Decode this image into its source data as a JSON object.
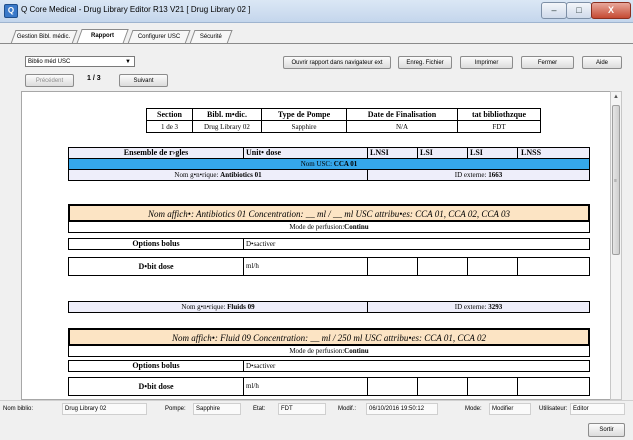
{
  "window": {
    "title": "Q Core Medical - Drug Library Editor R13 V21 [ Drug Library 02 ]",
    "app_icon": "Q",
    "minimize_glyph": "–",
    "maximize_glyph": "□",
    "close_glyph": "X"
  },
  "tabs": [
    {
      "label": "Gestion Bibl. médic."
    },
    {
      "label": "Rapport"
    },
    {
      "label": "Configurer USC"
    },
    {
      "label": "Sécurité"
    }
  ],
  "toolbar": {
    "biblio_select": "Biblio méd USC",
    "open_report": "Ouvrir rapport dans navigateur ext",
    "save_file": "Enreg. Fichier",
    "print": "Imprimer",
    "close": "Fermer",
    "help": "Aide",
    "previous": "Précédent",
    "page": "1 / 3",
    "next": "Suivant"
  },
  "summary": {
    "headers": [
      "Section",
      "Bibl. m•dic.",
      "Type de Pompe",
      "Date de Finalisation",
      "tat bibliothzque"
    ],
    "values": [
      "1 de 3",
      "Drug Library 02",
      "Sapphire",
      "N/A",
      "FDT"
    ]
  },
  "rules_header": {
    "ensemble": "Ensemble de r›gles",
    "unit": "Unit• dose",
    "lnsi": "LNSI",
    "lsi1": "LSI",
    "lsi2": "LSI",
    "lnss": "LNSS",
    "usc_prefix": "Nom USC: ",
    "usc_name": "CCA 01"
  },
  "drugs": [
    {
      "generic_prefix": "Nom g•n•rique: ",
      "generic_name": "Antibiotics 01",
      "ext_prefix": "ID externe: ",
      "ext_id": "1663",
      "display": "Nom affich•: Antibiotics 01 Concentration: __ ml / __ ml USC attribu•es: CCA 01, CCA 02, CCA 03",
      "mode_prefix": "Mode de perfusion:",
      "mode": "Continu",
      "bolus_label": "Options bolus",
      "bolus_value": "D•sactiver",
      "rate_label": "D•bit dose",
      "rate_unit": "ml/h"
    },
    {
      "generic_prefix": "Nom g•n•rique: ",
      "generic_name": "Fluids 09",
      "ext_prefix": "ID externe: ",
      "ext_id": "3293",
      "display": "Nom affich•: Fluid 09 Concentration: __ ml / 250 ml USC attribu•es: CCA 01, CCA 02",
      "mode_prefix": "Mode de perfusion:",
      "mode": "Continu",
      "bolus_label": "Options bolus",
      "bolus_value": "D•sactiver",
      "rate_label": "D•bit dose",
      "rate_unit": "ml/h"
    }
  ],
  "status": {
    "biblio_label": "Nom biblio:",
    "biblio_value": "Drug Library 02",
    "pump_label": "Pompe:",
    "pump_value": "Sapphire",
    "state_label": "Etat:",
    "state_value": "FDT",
    "modif_label": "Modif.:",
    "modif_value": "06/10/2016 19:50:12",
    "mode_label": "Mode:",
    "mode_value": "Modifier",
    "user_label": "Utilisateur:",
    "user_value": "Editor"
  },
  "footer": {
    "exit": "Sortir"
  },
  "colors": {
    "usc_bar": "#35a7ea",
    "row_lavender": "#eeeefa",
    "display_peach": "#fce4c4"
  }
}
